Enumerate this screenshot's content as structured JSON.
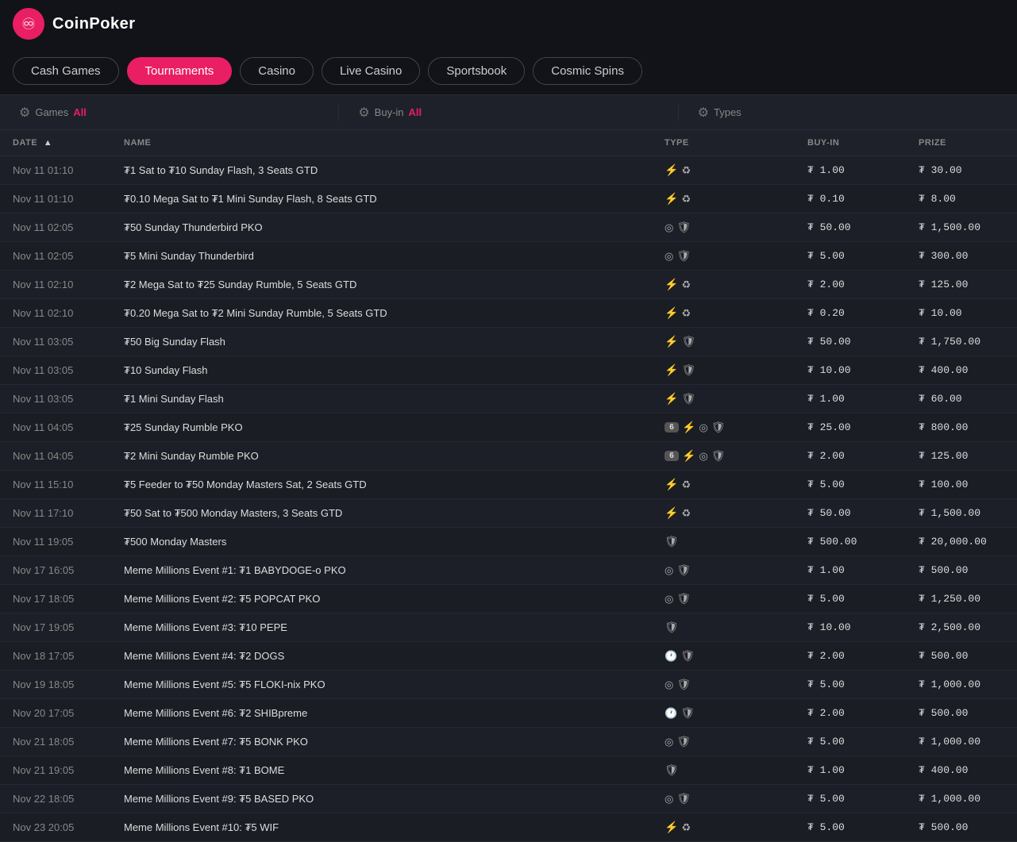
{
  "app": {
    "logo_text": "CoinPoker",
    "logo_icon": "♾"
  },
  "nav": {
    "items": [
      {
        "label": "Cash Games",
        "id": "cash-games",
        "active": false
      },
      {
        "label": "Tournaments",
        "id": "tournaments",
        "active": true
      },
      {
        "label": "Casino",
        "id": "casino",
        "active": false
      },
      {
        "label": "Live Casino",
        "id": "live-casino",
        "active": false
      },
      {
        "label": "Sportsbook",
        "id": "sportsbook",
        "active": false
      },
      {
        "label": "Cosmic Spins",
        "id": "cosmic-spins",
        "active": false
      }
    ]
  },
  "filters": {
    "games_label": "Games",
    "games_value": "All",
    "buyin_label": "Buy-in",
    "buyin_value": "All",
    "types_label": "Types"
  },
  "table": {
    "columns": [
      {
        "id": "date",
        "label": "DATE",
        "sortable": true
      },
      {
        "id": "name",
        "label": "NAME",
        "sortable": false
      },
      {
        "id": "type",
        "label": "TYPE",
        "sortable": false
      },
      {
        "id": "buyin",
        "label": "BUY-IN",
        "sortable": false
      },
      {
        "id": "prize",
        "label": "PRIZE",
        "sortable": false
      }
    ],
    "rows": [
      {
        "date": "Nov 11 01:10",
        "name": "₮1 Sat to ₮10 Sunday Flash, 3 Seats GTD",
        "type": "bolt_recycle",
        "buyin": "₮ 1.00",
        "prize": "₮ 30.00"
      },
      {
        "date": "Nov 11 01:10",
        "name": "₮0.10 Mega Sat to ₮1 Mini Sunday Flash, 8 Seats GTD",
        "type": "bolt_recycle",
        "buyin": "₮ 0.10",
        "prize": "₮ 8.00"
      },
      {
        "date": "Nov 11 02:05",
        "name": "₮50 Sunday Thunderbird PKO",
        "type": "target_shield",
        "buyin": "₮ 50.00",
        "prize": "₮ 1,500.00"
      },
      {
        "date": "Nov 11 02:05",
        "name": "₮5 Mini Sunday Thunderbird",
        "type": "target_shield",
        "buyin": "₮ 5.00",
        "prize": "₮ 300.00"
      },
      {
        "date": "Nov 11 02:10",
        "name": "₮2 Mega Sat to ₮25 Sunday Rumble, 5 Seats GTD",
        "type": "bolt_recycle",
        "buyin": "₮ 2.00",
        "prize": "₮ 125.00"
      },
      {
        "date": "Nov 11 02:10",
        "name": "₮0.20 Mega Sat to ₮2 Mini Sunday Rumble, 5 Seats GTD",
        "type": "bolt_recycle",
        "buyin": "₮ 0.20",
        "prize": "₮ 10.00"
      },
      {
        "date": "Nov 11 03:05",
        "name": "₮50 Big Sunday Flash",
        "type": "bolt_shield",
        "buyin": "₮ 50.00",
        "prize": "₮ 1,750.00"
      },
      {
        "date": "Nov 11 03:05",
        "name": "₮10 Sunday Flash",
        "type": "bolt_shield",
        "buyin": "₮ 10.00",
        "prize": "₮ 400.00"
      },
      {
        "date": "Nov 11 03:05",
        "name": "₮1 Mini Sunday Flash",
        "type": "bolt_shield",
        "buyin": "₮ 1.00",
        "prize": "₮ 60.00"
      },
      {
        "date": "Nov 11 04:05",
        "name": "₮25 Sunday Rumble PKO",
        "type": "6_bolt_target_shield",
        "buyin": "₮ 25.00",
        "prize": "₮ 800.00"
      },
      {
        "date": "Nov 11 04:05",
        "name": "₮2 Mini Sunday Rumble PKO",
        "type": "6_bolt_target_shield",
        "buyin": "₮ 2.00",
        "prize": "₮ 125.00"
      },
      {
        "date": "Nov 11 15:10",
        "name": "₮5 Feeder to ₮50 Monday Masters Sat, 2 Seats GTD",
        "type": "bolt_recycle",
        "buyin": "₮ 5.00",
        "prize": "₮ 100.00"
      },
      {
        "date": "Nov 11 17:10",
        "name": "₮50 Sat to ₮500 Monday Masters, 3 Seats GTD",
        "type": "bolt_recycle",
        "buyin": "₮ 50.00",
        "prize": "₮ 1,500.00"
      },
      {
        "date": "Nov 11 19:05",
        "name": "₮500 Monday Masters",
        "type": "shield",
        "buyin": "₮ 500.00",
        "prize": "₮ 20,000.00"
      },
      {
        "date": "Nov 17 16:05",
        "name": "Meme Millions Event #1: ₮1 BABYDOGE-o PKO",
        "type": "target_shield",
        "buyin": "₮ 1.00",
        "prize": "₮ 500.00"
      },
      {
        "date": "Nov 17 18:05",
        "name": "Meme Millions Event #2: ₮5 POPCAT PKO",
        "type": "target_shield",
        "buyin": "₮ 5.00",
        "prize": "₮ 1,250.00"
      },
      {
        "date": "Nov 17 19:05",
        "name": "Meme Millions Event #3: ₮10 PEPE",
        "type": "shield",
        "buyin": "₮ 10.00",
        "prize": "₮ 2,500.00"
      },
      {
        "date": "Nov 18 17:05",
        "name": "Meme Millions Event #4: ₮2 DOGS",
        "type": "clock_shield",
        "buyin": "₮ 2.00",
        "prize": "₮ 500.00"
      },
      {
        "date": "Nov 19 18:05",
        "name": "Meme Millions Event #5: ₮5 FLOKI-nix PKO",
        "type": "target_shield",
        "buyin": "₮ 5.00",
        "prize": "₮ 1,000.00"
      },
      {
        "date": "Nov 20 17:05",
        "name": "Meme Millions Event #6: ₮2 SHIBpreme",
        "type": "clock_shield",
        "buyin": "₮ 2.00",
        "prize": "₮ 500.00"
      },
      {
        "date": "Nov 21 18:05",
        "name": "Meme Millions Event #7: ₮5 BONK PKO",
        "type": "target_shield",
        "buyin": "₮ 5.00",
        "prize": "₮ 1,000.00"
      },
      {
        "date": "Nov 21 19:05",
        "name": "Meme Millions Event #8: ₮1 BOME",
        "type": "shield",
        "buyin": "₮ 1.00",
        "prize": "₮ 400.00"
      },
      {
        "date": "Nov 22 18:05",
        "name": "Meme Millions Event #9: ₮5 BASED PKO",
        "type": "target_shield",
        "buyin": "₮ 5.00",
        "prize": "₮ 1,000.00"
      },
      {
        "date": "Nov 23 20:05",
        "name": "Meme Millions Event #10: ₮5 WIF",
        "type": "bolt_recycle",
        "buyin": "₮ 5.00",
        "prize": "₮ 500.00"
      }
    ]
  }
}
